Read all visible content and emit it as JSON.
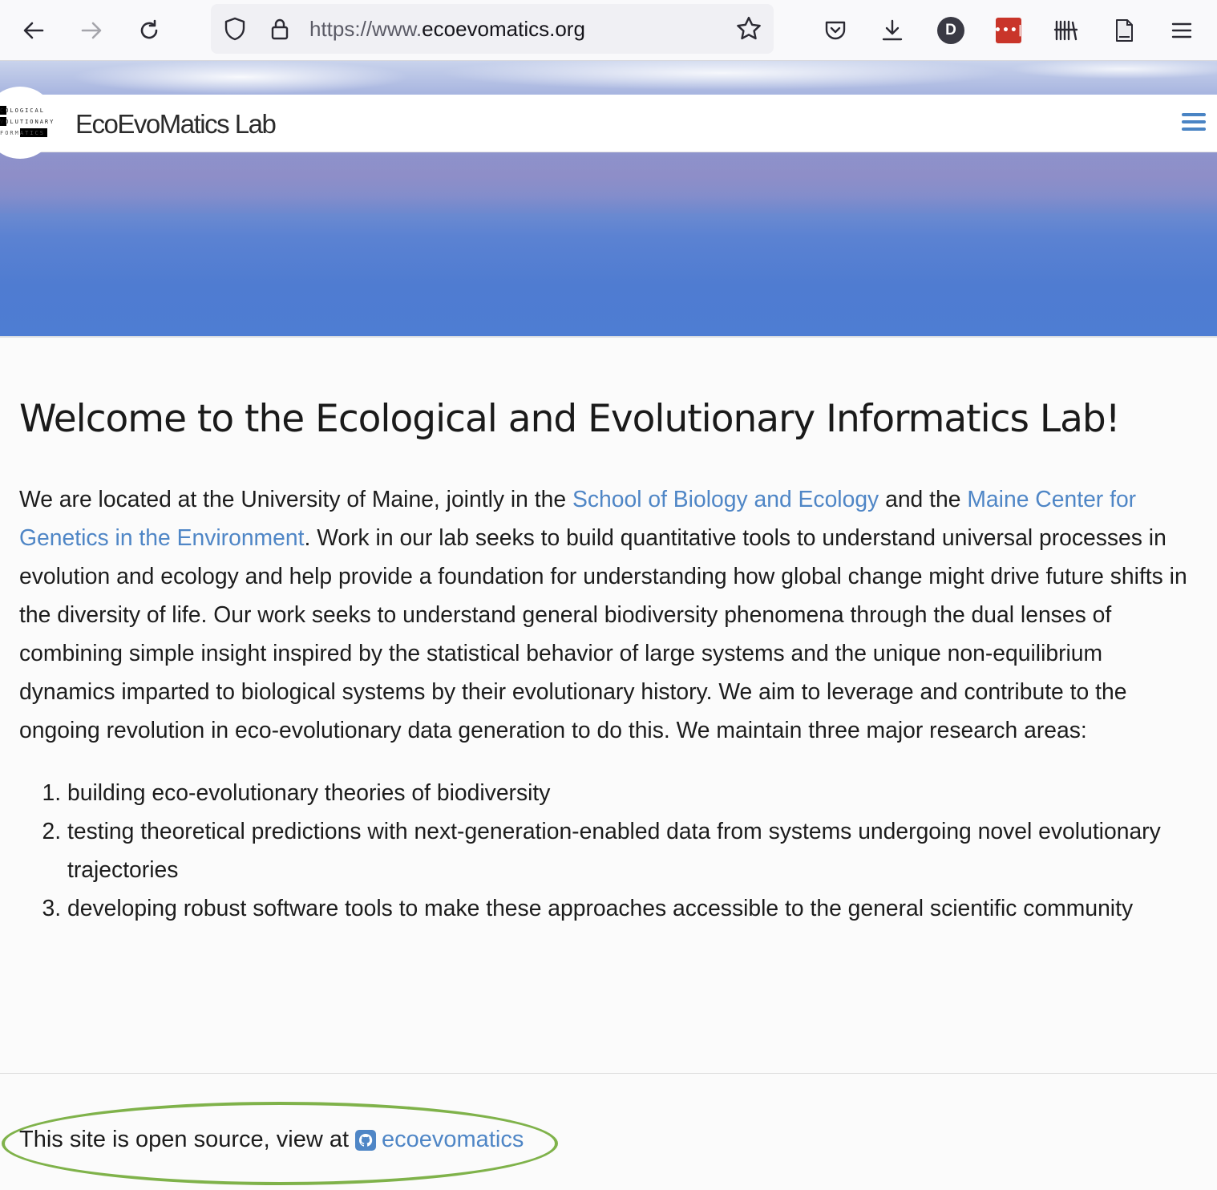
{
  "browser": {
    "url_prefix": "https://www.",
    "url_domain": "ecoevomatics.org",
    "profile_initial": "D",
    "extension_label": "•••|"
  },
  "site": {
    "brand": "EcoEvoMatics Lab",
    "logo": {
      "line1": "COLOGICAL",
      "line2": "VOLUTIONARY",
      "line3": "FORMATICS"
    }
  },
  "main": {
    "title": "Welcome to the Ecological and Evolutionary Informatics Lab!",
    "intro_part1": "We are located at the University of Maine, jointly in the ",
    "link_school": "School of Biology and Ecology",
    "intro_part2": " and the ",
    "link_center": "Maine Center for Genetics in the Environment",
    "intro_part3": ". Work in our lab seeks to build quantitative tools to understand universal processes in evolution and ecology and help provide a foundation for understanding how global change might drive future shifts in the diversity of life. Our work seeks to understand general biodiversity phenomena through the dual lenses of combining simple insight inspired by the statistical behavior of large systems and the unique non-equilibrium dynamics imparted to biological systems by their evolutionary history. We aim to leverage and contribute to the ongoing revolution in eco-evolutionary data generation to do this. We maintain three major research areas:",
    "areas": [
      "building eco-evolutionary theories of biodiversity",
      "testing theoretical predictions with next-generation-enabled data from systems undergoing novel evolutionary trajectories",
      "developing robust software tools to make these approaches accessible to the general scientific community"
    ]
  },
  "footer": {
    "text": "This site is open source, view at",
    "link": "ecoevomatics"
  },
  "colors": {
    "link": "#4f86c6",
    "annotation": "#7fb24a"
  }
}
